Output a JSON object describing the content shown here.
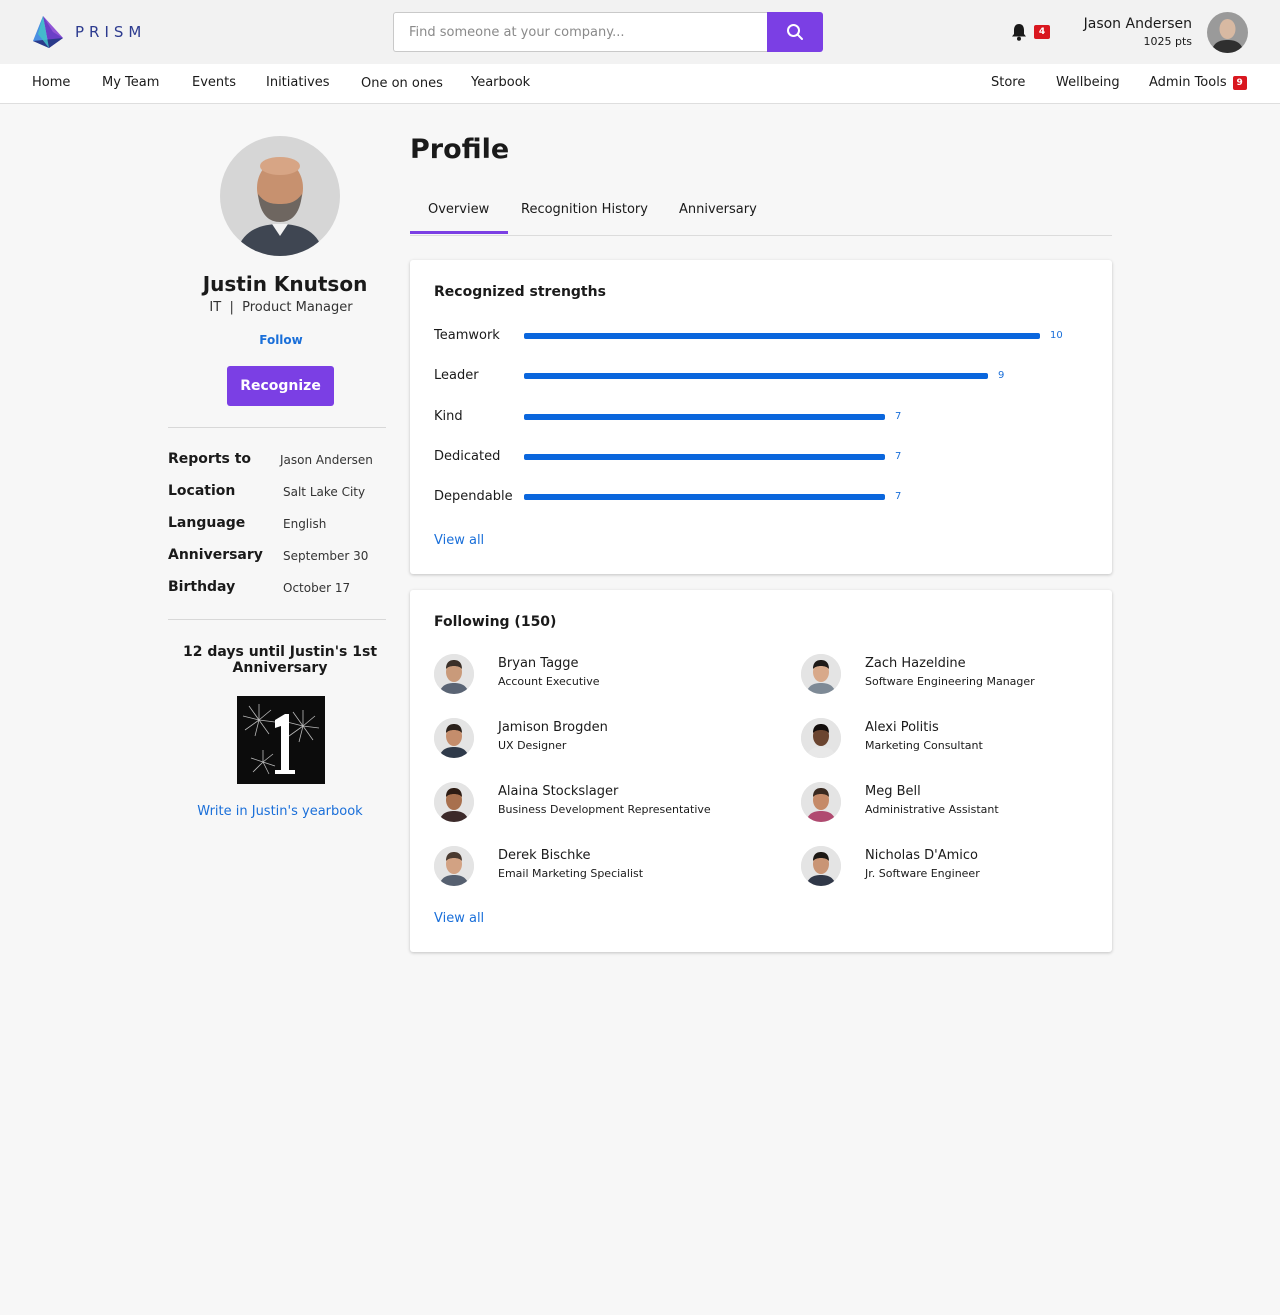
{
  "app": {
    "brand": "PRISM"
  },
  "header": {
    "search_placeholder": "Find someone at your company...",
    "notification_count": "4",
    "user_name": "Jason Andersen",
    "user_points": "1025 pts"
  },
  "nav": {
    "left": [
      "Home",
      "My Team",
      "Events",
      "Initiatives",
      "One on ones",
      "Yearbook"
    ],
    "right": [
      "Store",
      "Wellbeing",
      "Admin Tools"
    ],
    "admin_badge": "9"
  },
  "profile": {
    "name": "Justin Knutson",
    "department": "IT",
    "separator": "|",
    "title": "Product Manager",
    "follow_label": "Follow",
    "recognize_label": "Recognize",
    "details": [
      {
        "label": "Reports to",
        "value": "Jason Andersen"
      },
      {
        "label": "Location",
        "value": "Salt Lake City"
      },
      {
        "label": "Language",
        "value": "English"
      },
      {
        "label": "Anniversary",
        "value": "September 30"
      },
      {
        "label": "Birthday",
        "value": "October 17"
      }
    ],
    "anniversary_countdown": "12 days until Justin's 1st Anniversary",
    "anniversary_number": "1",
    "yearbook_link": "Write in Justin's yearbook"
  },
  "main": {
    "page_title": "Profile",
    "tabs": [
      "Overview",
      "Recognition History",
      "Anniversary"
    ],
    "active_tab": "Overview"
  },
  "strengths": {
    "title": "Recognized strengths",
    "view_all": "View all",
    "max": 10,
    "items": [
      {
        "name": "Teamwork",
        "count": 10
      },
      {
        "name": "Leader",
        "count": 9
      },
      {
        "name": "Kind",
        "count": 7
      },
      {
        "name": "Dedicated",
        "count": 7
      },
      {
        "name": "Dependable",
        "count": 7
      }
    ]
  },
  "following": {
    "title": "Following (150)",
    "view_all": "View all",
    "people": [
      {
        "name": "Bryan Tagge",
        "title": "Account Executive"
      },
      {
        "name": "Zach Hazeldine",
        "title": "Software Engineering Manager"
      },
      {
        "name": "Jamison Brogden",
        "title": "UX Designer"
      },
      {
        "name": "Alexi Politis",
        "title": "Marketing Consultant"
      },
      {
        "name": "Alaina Stockslager",
        "title": "Business Development Representative"
      },
      {
        "name": "Meg Bell",
        "title": "Administrative Assistant"
      },
      {
        "name": "Derek Bischke",
        "title": "Email Marketing Specialist"
      },
      {
        "name": "Nicholas D'Amico",
        "title": "Jr. Software Engineer"
      }
    ]
  },
  "colors": {
    "accent": "#7b3fe4",
    "link": "#1a6fd9",
    "bar": "#0a66dd",
    "badge": "#d9171f"
  }
}
